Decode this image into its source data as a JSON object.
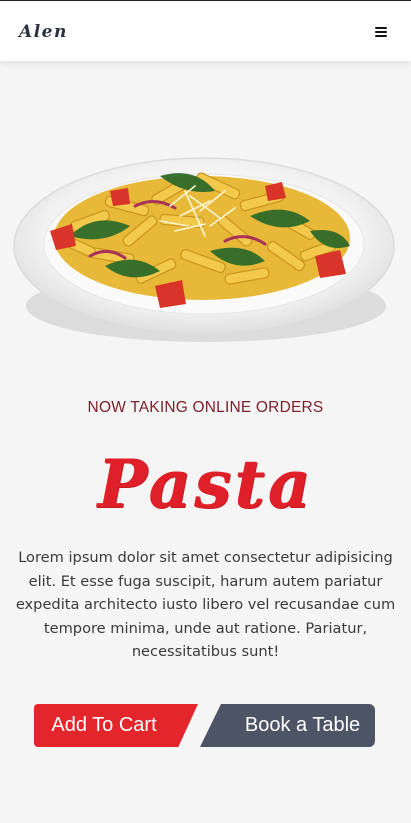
{
  "header": {
    "logo": "Alen",
    "menu_icon": "hamburger-menu-icon"
  },
  "hero": {
    "image": "pasta-dish-image",
    "tagline": "NOW TAKING ONLINE ORDERS",
    "title": "Pasta",
    "description": "Lorem ipsum dolor sit amet consectetur adipisicing elit. Et esse fuga suscipit, harum autem pariatur expedita architecto iusto libero vel recusandae cum tempore minima, unde aut ratione. Pariatur, necessitatibus sunt!"
  },
  "actions": {
    "add_to_cart_label": "Add To Cart",
    "book_table_label": "Book a Table"
  },
  "colors": {
    "accent_red": "#e3262c",
    "dark_slate": "#4c5465",
    "tagline_maroon": "#7d1f27",
    "background": "#f5f5f6"
  }
}
